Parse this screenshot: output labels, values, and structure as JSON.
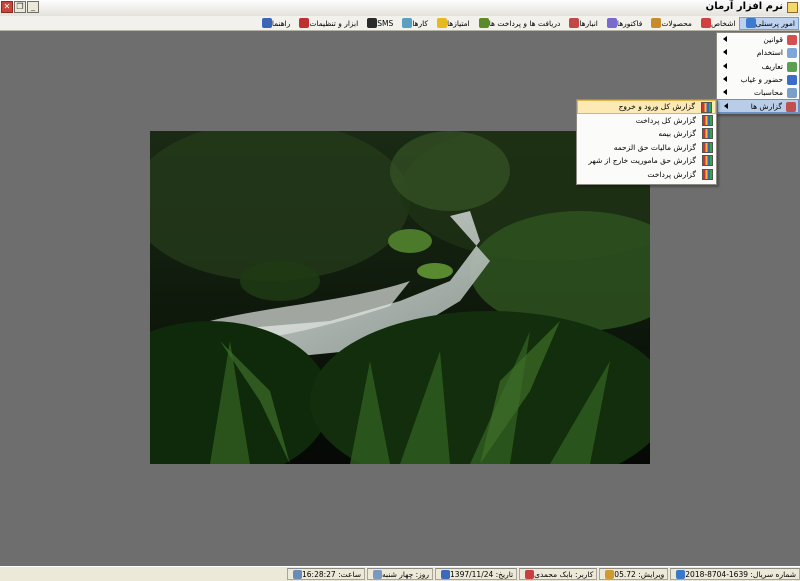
{
  "window": {
    "title": "نرم افزار آرمان"
  },
  "menu": [
    {
      "label": "امور پرسنلی",
      "icon": "people-icon",
      "color": "#3c7bd0",
      "active": true
    },
    {
      "label": "اشخاص",
      "icon": "people-icon",
      "color": "#d04040"
    },
    {
      "label": "محصولات",
      "icon": "box-icon",
      "color": "#c88a2a"
    },
    {
      "label": "فاکتورها",
      "icon": "invoice-icon",
      "color": "#7a6ad0"
    },
    {
      "label": "انبارها",
      "icon": "warehouse-icon",
      "color": "#c24848"
    },
    {
      "label": "دریافت ها و پرداخت ها",
      "icon": "payment-icon",
      "color": "#5c8a2a"
    },
    {
      "label": "امتیازها",
      "icon": "star-icon",
      "color": "#e8b820"
    },
    {
      "label": "کارها",
      "icon": "tasks-icon",
      "color": "#5aa0c0"
    },
    {
      "label": "SMS",
      "icon": "sms-icon",
      "color": "#2a2a2a"
    },
    {
      "label": "ابزار و تنظیمات",
      "icon": "tools-icon",
      "color": "#c03030"
    },
    {
      "label": "راهنما",
      "icon": "help-icon",
      "color": "#3b66b8"
    }
  ],
  "dropdown": [
    {
      "label": "قوانین",
      "icon": "document-icon",
      "color": "#d45050"
    },
    {
      "label": "استخدام",
      "icon": "hire-icon",
      "color": "#7fa6d8"
    },
    {
      "label": "تعاریف",
      "icon": "definitions-icon",
      "color": "#5aa050"
    },
    {
      "label": "حضور و غیاب",
      "icon": "clock-icon",
      "color": "#3a6cc8"
    },
    {
      "label": "محاسبات",
      "icon": "calculator-icon",
      "color": "#7aa0c8"
    },
    {
      "label": "گزارش ها",
      "icon": "reports-icon",
      "color": "#c05050",
      "highlighted": true
    }
  ],
  "submenu": [
    {
      "label": "گزارش کل ورود و خروج",
      "highlighted": true
    },
    {
      "label": "گزارش کل پرداخت"
    },
    {
      "label": "گزارش بیمه"
    },
    {
      "label": "گزارش مالیات حق الزحمه"
    },
    {
      "label": "گزارش حق ماموریت خارج از شهر"
    },
    {
      "label": "گزارش پرداخت"
    }
  ],
  "status": [
    {
      "label": "شماره سریال: 1639-8704-2018",
      "icon": "serial-icon",
      "color": "#3a78c8"
    },
    {
      "label": "ویرایش: 05.72",
      "icon": "edit-icon",
      "color": "#d09a30"
    },
    {
      "label": "کاربر: بابک محمدی",
      "icon": "user-icon",
      "color": "#c84040"
    },
    {
      "label": "تاریخ: 1397/11/24",
      "icon": "calendar-icon",
      "color": "#3a6ab8"
    },
    {
      "label": "روز: چهار شنبه",
      "icon": "day-icon",
      "color": "#7a98c0"
    },
    {
      "label": "ساعت: 16:28:27",
      "icon": "clock-icon",
      "color": "#6a8ab8"
    }
  ]
}
